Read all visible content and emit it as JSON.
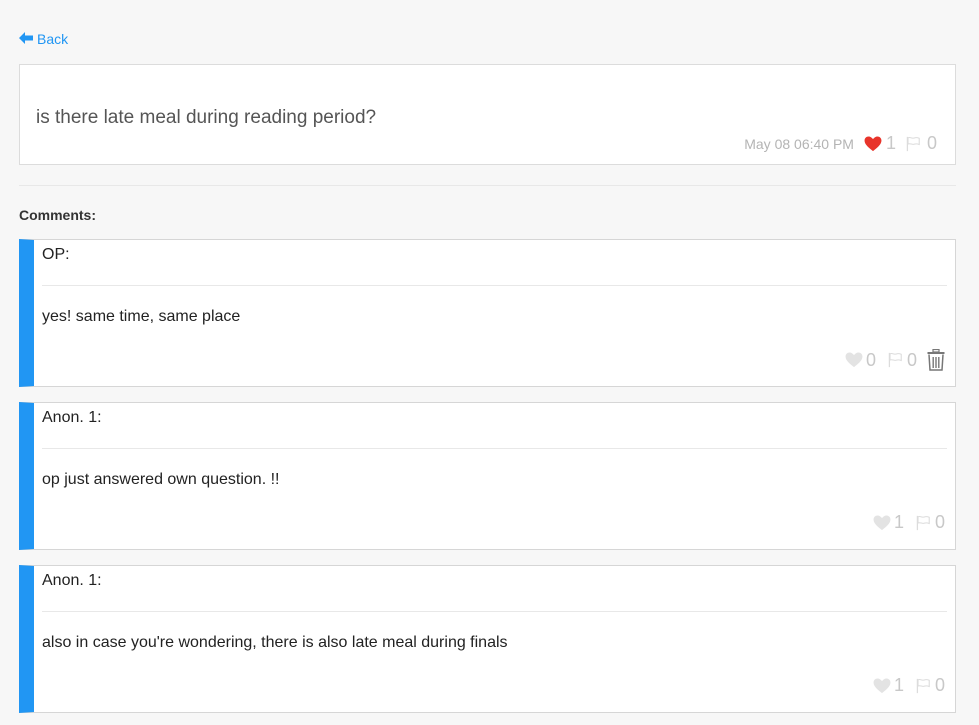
{
  "nav": {
    "back_label": "Back"
  },
  "post": {
    "text": "is there late meal during reading period?",
    "timestamp": "May 08 06:40 PM",
    "likes": "1",
    "flags": "0",
    "liked": true
  },
  "comments_label": "Comments:",
  "comments": [
    {
      "author": "OP:",
      "text": "yes! same time, same place",
      "likes": "0",
      "flags": "0",
      "deletable": true
    },
    {
      "author": "Anon. 1:",
      "text": "op just answered own question. !!",
      "likes": "1",
      "flags": "0",
      "deletable": false
    },
    {
      "author": "Anon. 1:",
      "text": "also in case you're wondering, there is also late meal during finals",
      "likes": "1",
      "flags": "0",
      "deletable": false
    }
  ],
  "colors": {
    "accent": "#2196f3",
    "liked_heart": "#e8342b",
    "inactive_icon": "#dcdcdc"
  },
  "icons": [
    "arrow-left-icon",
    "heart-icon",
    "flag-icon",
    "trash-icon"
  ]
}
